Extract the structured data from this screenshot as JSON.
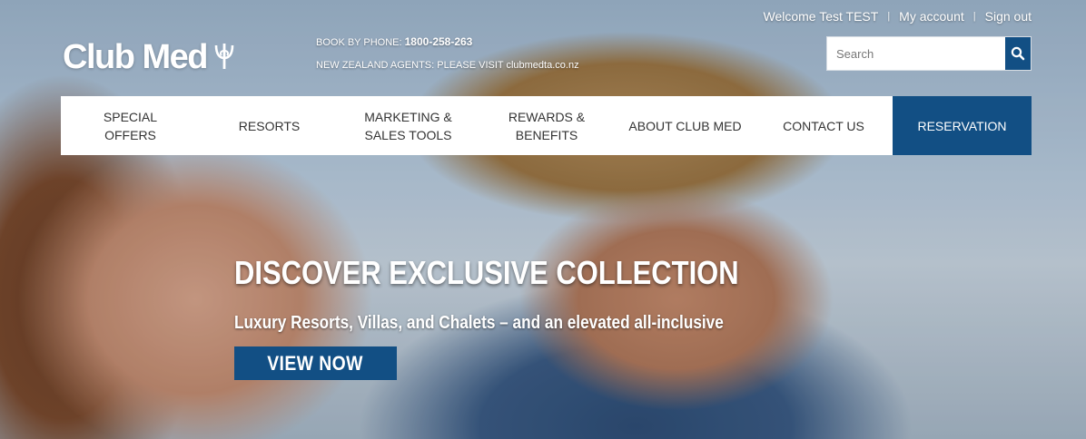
{
  "utility": {
    "welcome": "Welcome Test TEST",
    "separator": "|",
    "my_account": "My account",
    "sign_out": "Sign out"
  },
  "brand": {
    "name": "Club Med"
  },
  "contact": {
    "book_label": "BOOK BY PHONE:",
    "phone": "1800-258-263",
    "nz_notice": "NEW ZEALAND AGENTS: PLEASE VISIT clubmedta.co.nz"
  },
  "search": {
    "placeholder": "Search",
    "icon": "search-icon"
  },
  "nav": {
    "items": [
      {
        "label": "SPECIAL OFFERS"
      },
      {
        "label": "RESORTS"
      },
      {
        "label": "MARKETING & SALES TOOLS"
      },
      {
        "label": "REWARDS & BENEFITS"
      },
      {
        "label": "ABOUT CLUB MED"
      },
      {
        "label": "CONTACT US"
      },
      {
        "label": "RESERVATION"
      }
    ]
  },
  "hero": {
    "title": "DISCOVER EXCLUSIVE COLLECTION",
    "subtitle": "Luxury Resorts, Villas, and Chalets – and an elevated all-inclusive",
    "cta": "VIEW NOW"
  },
  "colors": {
    "brand_blue": "#124f84",
    "nav_bg": "#ffffff",
    "nav_text": "#333333"
  }
}
